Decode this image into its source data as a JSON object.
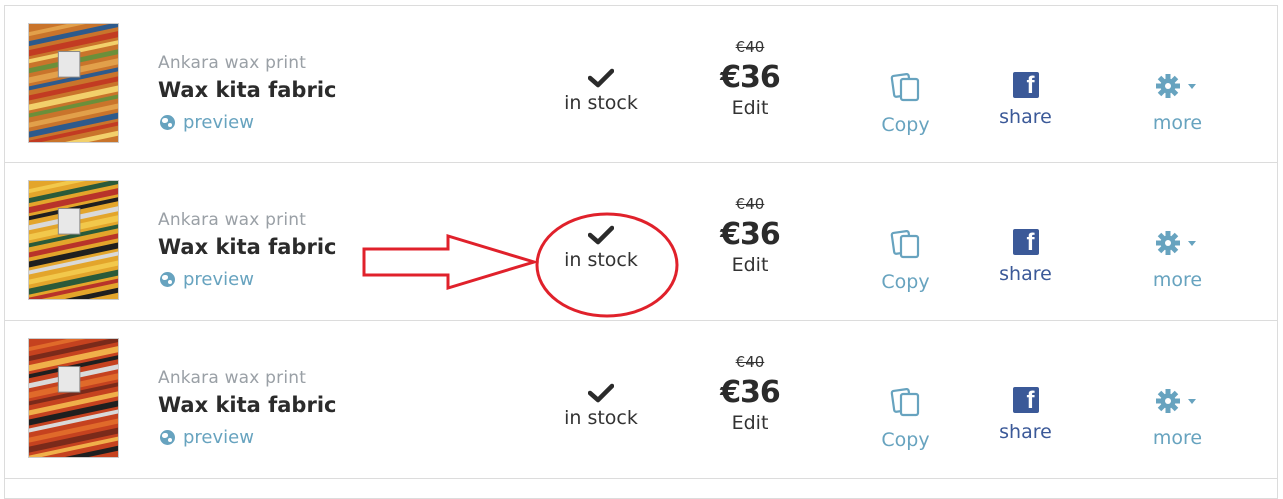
{
  "products": [
    {
      "category": "Ankara wax print",
      "title": "Wax kita fabric",
      "preview_label": "preview",
      "stock_label": "in stock",
      "old_price": "€40",
      "price": "€36",
      "edit_label": "Edit",
      "copy_label": "Copy",
      "share_label": "share",
      "more_label": "more",
      "thumb_palette": [
        "#c9742b",
        "#e2a04a",
        "#2d5a8c",
        "#c23b22",
        "#f2d06b",
        "#6b8f3a"
      ]
    },
    {
      "category": "Ankara wax print",
      "title": "Wax kita fabric",
      "preview_label": "preview",
      "stock_label": "in stock",
      "old_price": "€40",
      "price": "€36",
      "edit_label": "Edit",
      "copy_label": "Copy",
      "share_label": "share",
      "more_label": "more",
      "thumb_palette": [
        "#e3a52b",
        "#f2c84b",
        "#2a5a3a",
        "#b8332a",
        "#1f1f1f",
        "#d9d9d9"
      ]
    },
    {
      "category": "Ankara wax print",
      "title": "Wax kita fabric",
      "preview_label": "preview",
      "stock_label": "in stock",
      "old_price": "€40",
      "price": "€36",
      "edit_label": "Edit",
      "copy_label": "Copy",
      "share_label": "share",
      "more_label": "more",
      "thumb_palette": [
        "#c5421f",
        "#e06a2a",
        "#7a2a1a",
        "#f0b04a",
        "#1f1f1f",
        "#d9d9d9"
      ]
    }
  ],
  "icons": {
    "stock": "check-icon",
    "preview": "globe-icon",
    "copy": "copy-icon",
    "share": "facebook-icon",
    "more": "gear-icon",
    "more_caret": "caret-down-icon"
  },
  "colors": {
    "accent": "#67a3bf",
    "facebook": "#3b5998",
    "annotation": "#e0212b",
    "border": "#dcdcdc"
  }
}
